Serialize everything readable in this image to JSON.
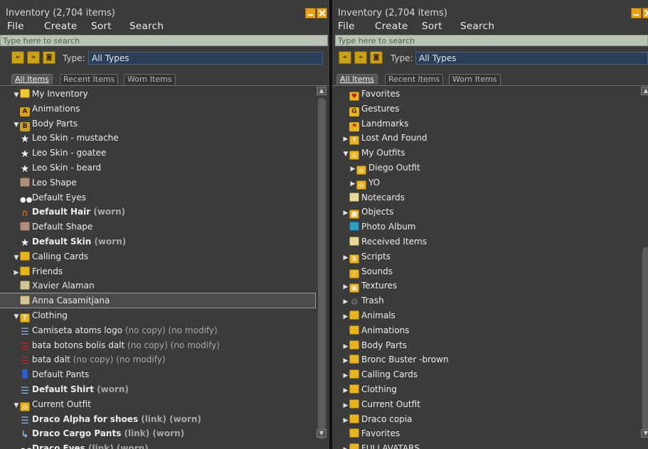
{
  "window_title": "Inventory (2,704 items)",
  "menu": [
    "File",
    "Create",
    "Sort",
    "Search"
  ],
  "search_placeholder": "Type here to search",
  "type_label": "Type:",
  "type_value": "All Types",
  "tabs": [
    "All Items",
    "Recent Items",
    "Worn Items"
  ],
  "left_tree": [
    {
      "arrow": "down",
      "icon": "open-folder",
      "label": "My Inventory"
    },
    {
      "icon": "animations",
      "label": "Animations"
    },
    {
      "arrow": "down",
      "icon": "bodyparts-folder",
      "label": "Body Parts"
    },
    {
      "icon": "person",
      "label": "Leo Skin - mustache"
    },
    {
      "icon": "person",
      "label": "Leo Skin - goatee"
    },
    {
      "icon": "person",
      "label": "Leo Skin - beard"
    },
    {
      "icon": "shape",
      "label": "Leo Shape"
    },
    {
      "icon": "eyes",
      "label": "Default Eyes"
    },
    {
      "icon": "hair",
      "label": "Default Hair",
      "bold": true,
      "suffix": " (worn)"
    },
    {
      "icon": "shape",
      "label": "Default Shape"
    },
    {
      "icon": "person",
      "label": "Default Skin",
      "bold": true,
      "suffix": " (worn)"
    },
    {
      "arrow": "down",
      "icon": "folder",
      "label": "Calling Cards"
    },
    {
      "arrow": "right",
      "icon": "folder",
      "label": "Friends"
    },
    {
      "icon": "card",
      "label": "Xavier Alaman"
    },
    {
      "icon": "card",
      "label": "Anna Casamitjana",
      "selected": true
    },
    {
      "arrow": "down",
      "icon": "clothing-folder",
      "label": "Clothing"
    },
    {
      "icon": "shirt",
      "label": "Camiseta atoms logo",
      "suffix": " (no copy) (no modify)"
    },
    {
      "icon": "red-jacket",
      "label": "bata botons bolis dalt",
      "suffix": " (no copy) (no modify)"
    },
    {
      "icon": "red-jacket",
      "label": "bata dalt",
      "suffix": " (no copy) (no modify)"
    },
    {
      "icon": "pants",
      "label": "Default Pants"
    },
    {
      "icon": "shirt",
      "label": "Default Shirt",
      "bold": true,
      "suffix": " (worn)"
    },
    {
      "arrow": "down",
      "icon": "outfit-folder",
      "label": "Current Outfit"
    },
    {
      "icon": "shoes",
      "label": "Draco Alpha for shoes",
      "bold": true,
      "suffix": " (link) (worn)"
    },
    {
      "icon": "pants-link",
      "label": "Draco Cargo Pants",
      "bold": true,
      "suffix": " (link) (worn)"
    },
    {
      "icon": "eyes",
      "label": "Draco Eyes",
      "bold": true,
      "suffix": " (link) (worn)"
    }
  ],
  "right_tree": [
    {
      "icon": "favorites",
      "label": "Favorites"
    },
    {
      "icon": "gestures",
      "label": "Gestures"
    },
    {
      "icon": "landmarks",
      "label": "Landmarks"
    },
    {
      "arrow": "right",
      "icon": "lost-found",
      "label": "Lost And Found"
    },
    {
      "arrow": "down",
      "icon": "outfit-folder",
      "label": "My Outfits"
    },
    {
      "arrow": "right",
      "icon": "outfit-folder",
      "label": "Diego Outfit",
      "indent": 1
    },
    {
      "arrow": "right",
      "icon": "outfit-folder",
      "label": "YO",
      "indent": 1
    },
    {
      "icon": "notecards",
      "label": "Notecards"
    },
    {
      "arrow": "right",
      "icon": "objects",
      "label": "Objects"
    },
    {
      "icon": "photo",
      "label": "Photo Album"
    },
    {
      "icon": "received",
      "label": "Received Items"
    },
    {
      "arrow": "right",
      "icon": "scripts",
      "label": "Scripts"
    },
    {
      "icon": "sounds",
      "label": "Sounds"
    },
    {
      "arrow": "right",
      "icon": "textures",
      "label": "Textures"
    },
    {
      "arrow": "right",
      "icon": "trash",
      "label": "Trash"
    },
    {
      "arrow": "right",
      "icon": "folder",
      "label": "Animals"
    },
    {
      "icon": "folder",
      "label": "Animations"
    },
    {
      "arrow": "right",
      "icon": "folder",
      "label": "Body Parts"
    },
    {
      "arrow": "right",
      "icon": "folder",
      "label": "Bronc Buster -brown"
    },
    {
      "arrow": "right",
      "icon": "folder",
      "label": "Calling Cards"
    },
    {
      "arrow": "right",
      "icon": "folder",
      "label": "Clothing"
    },
    {
      "arrow": "right",
      "icon": "folder",
      "label": "Current Outfit"
    },
    {
      "arrow": "right",
      "icon": "folder",
      "label": "Draco copia"
    },
    {
      "icon": "folder",
      "label": "Favorites"
    },
    {
      "arrow": "right",
      "icon": "folder",
      "label": "FULLAVATARS"
    }
  ]
}
